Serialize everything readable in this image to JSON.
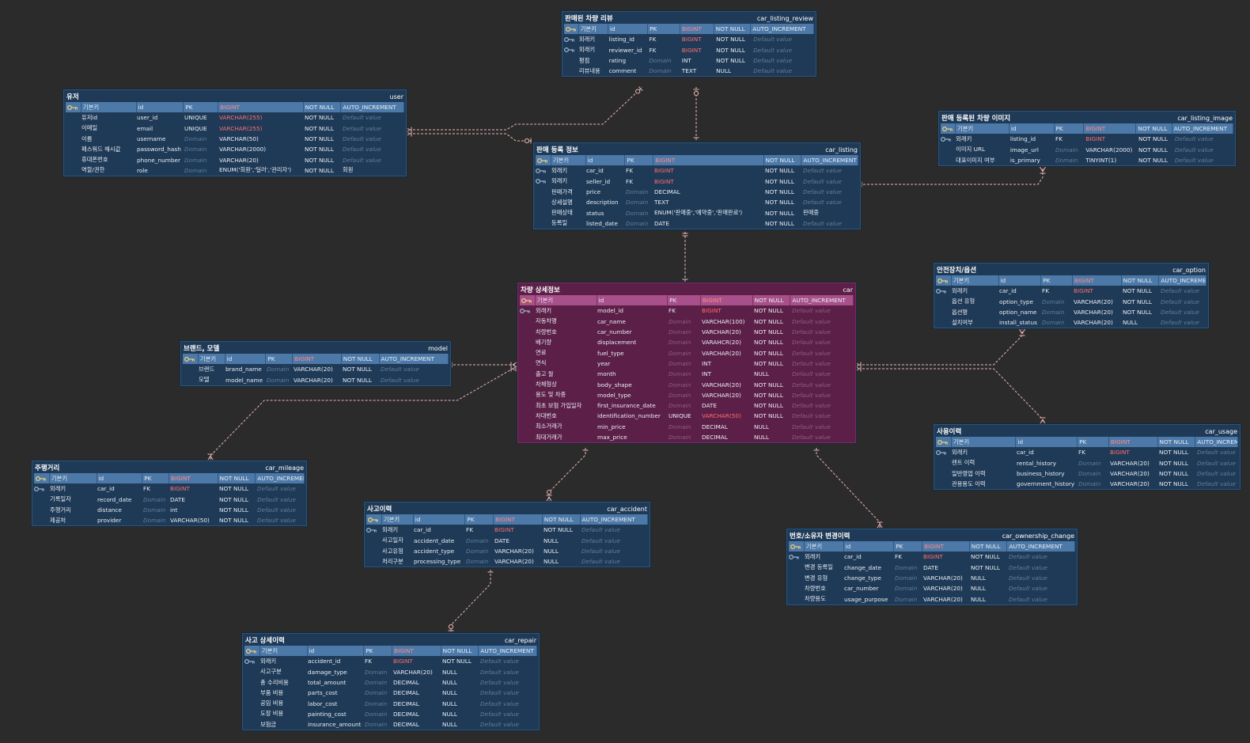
{
  "tables": [
    {
      "key": "car_listing_review",
      "title": "판매된 차량 리뷰",
      "phys": "car_listing_review",
      "rows": [
        [
          "기본키",
          "id",
          "PK",
          "BIGINT",
          "NOT NULL",
          "AUTO_INCREMENT"
        ],
        [
          "외래키",
          "listing_id",
          "FK",
          "BIGINT",
          "NOT NULL",
          "Default value"
        ],
        [
          "외래키",
          "reviewer_id",
          "FK",
          "BIGINT",
          "NOT NULL",
          "Default value"
        ],
        [
          "평점",
          "rating",
          "Domain",
          "INT",
          "NOT NULL",
          "Default value"
        ],
        [
          "리뷰내용",
          "comment",
          "Domain",
          "TEXT",
          "NULL",
          "Default value"
        ]
      ]
    },
    {
      "key": "user",
      "title": "유저",
      "phys": "user",
      "rows": [
        [
          "기본키",
          "id",
          "PK",
          "BIGINT",
          "NOT NULL",
          "AUTO_INCREMENT"
        ],
        [
          "유저id",
          "user_id",
          "UNIQUE",
          "VARCHAR(255)",
          "NOT NULL",
          "Default value"
        ],
        [
          "이메일",
          "email",
          "UNIQUE",
          "VARCHAR(255)",
          "NOT NULL",
          "Default value"
        ],
        [
          "이름",
          "username",
          "Domain",
          "VARCHAR(50)",
          "NOT NULL",
          "Default value"
        ],
        [
          "패스워드 해시값",
          "password_hash",
          "Domain",
          "VARCHAR(2000)",
          "NOT NULL",
          "Default value"
        ],
        [
          "휴대폰번호",
          "phone_number",
          "Domain",
          "VARCHAR(20)",
          "NOT NULL",
          "Default value"
        ],
        [
          "역할/권한",
          "role",
          "Domain",
          "ENUM('회원','딜러','관리자')",
          "NOT NULL",
          "회원"
        ]
      ]
    },
    {
      "key": "car_listing_image",
      "title": "판매 등록된 차량 이미지",
      "phys": "car_listing_image",
      "rows": [
        [
          "기본키",
          "id",
          "PK",
          "BIGINT",
          "NOT NULL",
          "AUTO_INCREMENT"
        ],
        [
          "외래키",
          "listing_id",
          "FK",
          "BIGINT",
          "NOT NULL",
          "Default value"
        ],
        [
          "이미지 URL",
          "image_url",
          "Domain",
          "VARCHAR(2000)",
          "NOT NULL",
          "Default value"
        ],
        [
          "대표이미지 여부",
          "is_primary",
          "Domain",
          "TINYINT(1)",
          "NOT NULL",
          "Default value"
        ]
      ]
    },
    {
      "key": "car_listing",
      "title": "판매 등록 정보",
      "phys": "car_listing",
      "rows": [
        [
          "기본키",
          "id",
          "PK",
          "BIGINT",
          "NOT NULL",
          "AUTO_INCREMENT"
        ],
        [
          "외래키",
          "car_id",
          "FK",
          "BIGINT",
          "NOT NULL",
          "Default value"
        ],
        [
          "외래키",
          "seller_id",
          "FK",
          "BIGINT",
          "NOT NULL",
          "Default value"
        ],
        [
          "판매가격",
          "price",
          "Domain",
          "DECIMAL",
          "NOT NULL",
          "Default value"
        ],
        [
          "상세설명",
          "description",
          "Domain",
          "TEXT",
          "NOT NULL",
          "Default value"
        ],
        [
          "판매상태",
          "status",
          "Domain",
          "ENUM('판매중','예약중','판매완료')",
          "NOT NULL",
          "판매중"
        ],
        [
          "등록일",
          "listed_date",
          "Domain",
          "DATE",
          "NOT NULL",
          "Default value"
        ]
      ]
    },
    {
      "key": "car_option",
      "title": "안전장치/옵션",
      "phys": "car_option",
      "rows": [
        [
          "기본키",
          "id",
          "PK",
          "BIGINT",
          "NOT NULL",
          "AUTO_INCREMENT"
        ],
        [
          "외래키",
          "car_id",
          "FK",
          "BIGINT",
          "NOT NULL",
          "Default value"
        ],
        [
          "옵션 유형",
          "option_type",
          "Domain",
          "VARCHAR(20)",
          "NOT NULL",
          "Default value"
        ],
        [
          "옵션명",
          "option_name",
          "Domain",
          "VARCHAR(20)",
          "NOT NULL",
          "Default value"
        ],
        [
          "설치여부",
          "install_status",
          "Domain",
          "VARCHAR(20)",
          "NULL",
          "Default value"
        ]
      ]
    },
    {
      "key": "car",
      "title": "차량 상세정보",
      "phys": "car",
      "rows": [
        [
          "기본키",
          "id",
          "PK",
          "BIGINT",
          "NOT NULL",
          "AUTO_INCREMENT"
        ],
        [
          "외래키",
          "model_id",
          "FK",
          "BIGINT",
          "NOT NULL",
          "Default value"
        ],
        [
          "자동차명",
          "car_name",
          "Domain",
          "VARCHAR(100)",
          "NOT NULL",
          "Default value"
        ],
        [
          "차량번호",
          "car_number",
          "Domain",
          "VARCHAR(20)",
          "NOT NULL",
          "Default value"
        ],
        [
          "배기량",
          "displacement",
          "Domain",
          "VARAHCR(20)",
          "NOT NULL",
          "Default value"
        ],
        [
          "연료",
          "fuel_type",
          "Domain",
          "VARCHAR(20)",
          "NOT NULL",
          "Default value"
        ],
        [
          "연식",
          "year",
          "Domain",
          "INT",
          "NOT NULL",
          "Default value"
        ],
        [
          "출고 월",
          "month",
          "Domain",
          "INT",
          "NULL",
          "Default value"
        ],
        [
          "차체형상",
          "body_shape",
          "Domain",
          "VARCHAR(20)",
          "NOT NULL",
          "Default value"
        ],
        [
          "용도 및 차종",
          "model_type",
          "Domain",
          "VARCHAR(20)",
          "NOT NULL",
          "Default value"
        ],
        [
          "최초 보험 가입일자",
          "first_insurance_date",
          "Domain",
          "DATE",
          "NOT NULL",
          "Default value"
        ],
        [
          "차대번호",
          "identification_number",
          "UNIQUE",
          "VARCHAR(50)",
          "NOT NULL",
          "Default value"
        ],
        [
          "최소거래가",
          "min_price",
          "Domain",
          "DECIMAL",
          "NULL",
          "Default value"
        ],
        [
          "최대거래가",
          "max_price",
          "Domain",
          "DECIMAL",
          "NULL",
          "Default value"
        ]
      ]
    },
    {
      "key": "model",
      "title": "브랜드, 모델",
      "phys": "model",
      "rows": [
        [
          "기본키",
          "id",
          "PK",
          "BIGINT",
          "NOT NULL",
          "AUTO_INCREMENT"
        ],
        [
          "브랜드",
          "brand_name",
          "Domain",
          "VARCHAR(20)",
          "NOT NULL",
          "Default value"
        ],
        [
          "모델",
          "model_name",
          "Domain",
          "VARCHAR(20)",
          "NOT NULL",
          "Default value"
        ]
      ]
    },
    {
      "key": "car_usage",
      "title": "사용이력",
      "phys": "car_usage",
      "rows": [
        [
          "기본키",
          "id",
          "PK",
          "BIGINT",
          "NOT NULL",
          "AUTO_INCREMENT"
        ],
        [
          "외래키",
          "car_id",
          "FK",
          "BIGINT",
          "NOT NULL",
          "Default value"
        ],
        [
          "렌트 이력",
          "rental_history",
          "Domain",
          "VARCHAR(20)",
          "NOT NULL",
          "Default value"
        ],
        [
          "일반영업 이력",
          "business_history",
          "Domain",
          "VARCHAR(20)",
          "NOT NULL",
          "Default value"
        ],
        [
          "관용용도 이력",
          "government_history",
          "Domain",
          "VARCHAR(20)",
          "NOT NULL",
          "Default value"
        ]
      ]
    },
    {
      "key": "car_mileage",
      "title": "주행거리",
      "phys": "car_mileage",
      "rows": [
        [
          "기본키",
          "id",
          "PK",
          "BIGINT",
          "NOT NULL",
          "AUTO_INCREMENT"
        ],
        [
          "외래키",
          "car_id",
          "FK",
          "BIGINT",
          "NOT NULL",
          "Default value"
        ],
        [
          "기록일자",
          "record_date",
          "Domain",
          "DATE",
          "NOT NULL",
          "Default value"
        ],
        [
          "주행거리",
          "distance",
          "Domain",
          "int",
          "NOT NULL",
          "Default value"
        ],
        [
          "제공처",
          "provider",
          "Domain",
          "VARCHAR(50)",
          "NOT NULL",
          "Default value"
        ]
      ]
    },
    {
      "key": "car_accident",
      "title": "사고이력",
      "phys": "car_accident",
      "rows": [
        [
          "기본키",
          "id",
          "PK",
          "BIGINT",
          "NOT NULL",
          "AUTO_INCREMENT"
        ],
        [
          "외래키",
          "car_id",
          "FK",
          "BIGINT",
          "NOT NULL",
          "Default value"
        ],
        [
          "사고일자",
          "accident_date",
          "Domain",
          "DATE",
          "NULL",
          "Default value"
        ],
        [
          "사고유형",
          "accident_type",
          "Domain",
          "VARCHAR(20)",
          "NULL",
          "Default value"
        ],
        [
          "처리구분",
          "processing_type",
          "Domain",
          "VARCHAR(20)",
          "NULL",
          "Default value"
        ]
      ]
    },
    {
      "key": "car_ownership_change",
      "title": "번호/소유자 변경이력",
      "phys": "car_ownership_change",
      "rows": [
        [
          "기본키",
          "id",
          "PK",
          "BIGINT",
          "NOT NULL",
          "AUTO_INCREMENT"
        ],
        [
          "외래키",
          "car_id",
          "FK",
          "BIGINT",
          "NOT NULL",
          "Default value"
        ],
        [
          "변경 등록일",
          "change_date",
          "Domain",
          "DATE",
          "NOT NULL",
          "Default value"
        ],
        [
          "변경 유형",
          "change_type",
          "Domain",
          "VARCHAR(20)",
          "NULL",
          "Default value"
        ],
        [
          "차량번호",
          "car_number",
          "Domain",
          "VARCHAR(20)",
          "NULL",
          "Default value"
        ],
        [
          "차량용도",
          "usage_purpose",
          "Domain",
          "VARCHAR(20)",
          "NULL",
          "Default value"
        ]
      ]
    },
    {
      "key": "car_repair",
      "title": "사고 상세이력",
      "phys": "car_repair",
      "rows": [
        [
          "기본키",
          "id",
          "PK",
          "BIGINT",
          "NOT NULL",
          "AUTO_INCREMENT"
        ],
        [
          "외래키",
          "accident_id",
          "FK",
          "BIGINT",
          "NOT NULL",
          "Default value"
        ],
        [
          "사고구분",
          "damage_type",
          "Domain",
          "VARCHAR(20)",
          "NULL",
          "Default value"
        ],
        [
          "총 수리비용",
          "total_amount",
          "Domain",
          "DECIMAL",
          "NULL",
          "Default value"
        ],
        [
          "부품 비용",
          "parts_cost",
          "Domain",
          "DECIMAL",
          "NULL",
          "Default value"
        ],
        [
          "공임 비용",
          "labor_cost",
          "Domain",
          "DECIMAL",
          "NULL",
          "Default value"
        ],
        [
          "도장 비용",
          "painting_cost",
          "Domain",
          "DECIMAL",
          "NULL",
          "Default value"
        ],
        [
          "보험금",
          "insurance_amount",
          "Domain",
          "DECIMAL",
          "NULL",
          "Default value"
        ]
      ]
    }
  ],
  "relationships": [
    {
      "from": "user",
      "to": "car_listing_review"
    },
    {
      "from": "user",
      "to": "car_listing"
    },
    {
      "from": "car_listing",
      "to": "car_listing_review"
    },
    {
      "from": "car_listing",
      "to": "car_listing_image"
    },
    {
      "from": "car",
      "to": "car_listing"
    },
    {
      "from": "model",
      "to": "car"
    },
    {
      "from": "car",
      "to": "car_option"
    },
    {
      "from": "car",
      "to": "car_usage"
    },
    {
      "from": "car",
      "to": "car_mileage"
    },
    {
      "from": "car",
      "to": "car_accident"
    },
    {
      "from": "car",
      "to": "car_ownership_change"
    },
    {
      "from": "car_accident",
      "to": "car_repair"
    }
  ],
  "icons": {
    "primary_key": "key-icon",
    "foreign_key": "foreign-key-icon"
  },
  "colors": {
    "background": "#2b2b2b",
    "entity": "#1f3a57",
    "entity_highlight": "#5c1f47",
    "relationship_line": "#e8b4b4",
    "type_bigint": "#ff6d6d",
    "key_icon": "#f2d27a"
  }
}
